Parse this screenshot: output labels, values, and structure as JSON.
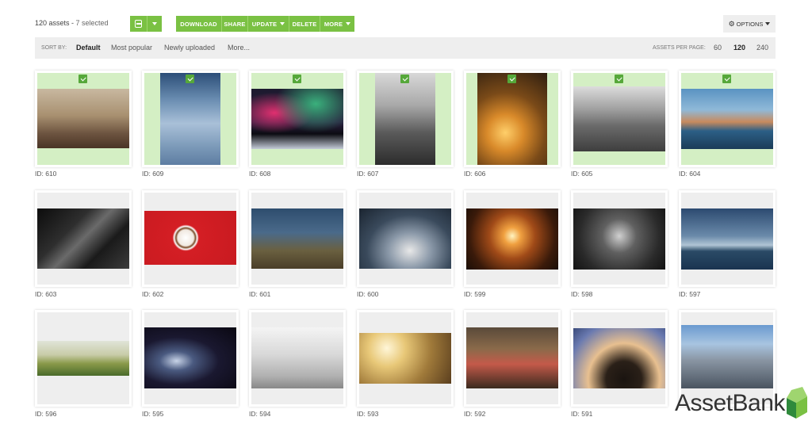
{
  "header": {
    "asset_count": "120 assets",
    "separator": " - ",
    "selected_text": "7 selected",
    "buttons": {
      "download": "DOWNLOAD",
      "share": "SHARE",
      "update": "UPDATE",
      "delete": "DELETE",
      "more": "MORE"
    },
    "options": "OPTIONS",
    "accent_color": "#7ac143"
  },
  "sort": {
    "label": "SORT BY:",
    "options": [
      "Default",
      "Most popular",
      "Newly uploaded",
      "More..."
    ],
    "active": "Default",
    "per_page_label": "ASSETS PER PAGE:",
    "per_page": [
      "60",
      "120",
      "240"
    ],
    "per_page_active": "120"
  },
  "assets": [
    {
      "id": "ID: 610",
      "selected": true
    },
    {
      "id": "ID: 609",
      "selected": true
    },
    {
      "id": "ID: 608",
      "selected": true
    },
    {
      "id": "ID: 607",
      "selected": true
    },
    {
      "id": "ID: 606",
      "selected": true
    },
    {
      "id": "ID: 605",
      "selected": true
    },
    {
      "id": "ID: 604",
      "selected": true
    },
    {
      "id": "ID: 603",
      "selected": false
    },
    {
      "id": "ID: 602",
      "selected": false
    },
    {
      "id": "ID: 601",
      "selected": false
    },
    {
      "id": "ID: 600",
      "selected": false
    },
    {
      "id": "ID: 599",
      "selected": false
    },
    {
      "id": "ID: 598",
      "selected": false
    },
    {
      "id": "ID: 597",
      "selected": false
    },
    {
      "id": "ID: 596",
      "selected": false
    },
    {
      "id": "ID: 595",
      "selected": false
    },
    {
      "id": "ID: 594",
      "selected": false
    },
    {
      "id": "ID: 593",
      "selected": false
    },
    {
      "id": "ID: 592",
      "selected": false
    },
    {
      "id": "ID: 591",
      "selected": false
    },
    {
      "id": "",
      "selected": false
    }
  ],
  "logo": "AssetBank",
  "selected_color": "#d4efc4"
}
